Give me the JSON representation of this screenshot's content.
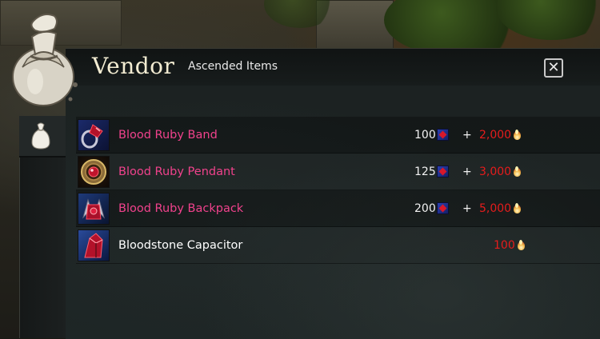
{
  "window": {
    "title": "Vendor",
    "subtitle": "Ascended Items",
    "close_icon": "close-icon",
    "close_label": "✕"
  },
  "colors": {
    "ascended_name": "#f0428c",
    "normal_name": "#ffffff",
    "karma_amount": "#e61c1c",
    "title": "#f3ecd2"
  },
  "items": [
    {
      "name": "Blood Ruby Band",
      "rarity": "ascended",
      "icon": "ring-icon",
      "gem_cost": "100",
      "currency_icon": "blood-ruby-icon",
      "plus": "+",
      "karma_cost": "2,000",
      "karma_icon": "karma-icon"
    },
    {
      "name": "Blood Ruby Pendant",
      "rarity": "ascended",
      "icon": "amulet-icon",
      "gem_cost": "125",
      "currency_icon": "blood-ruby-icon",
      "plus": "+",
      "karma_cost": "3,000",
      "karma_icon": "karma-icon"
    },
    {
      "name": "Blood Ruby Backpack",
      "rarity": "ascended",
      "icon": "backpack-icon",
      "gem_cost": "200",
      "currency_icon": "blood-ruby-icon",
      "plus": "+",
      "karma_cost": "5,000",
      "karma_icon": "karma-icon"
    },
    {
      "name": "Bloodstone Capacitor",
      "rarity": "basic",
      "icon": "capacitor-icon",
      "karma_cost": "100",
      "karma_icon": "karma-icon"
    }
  ]
}
